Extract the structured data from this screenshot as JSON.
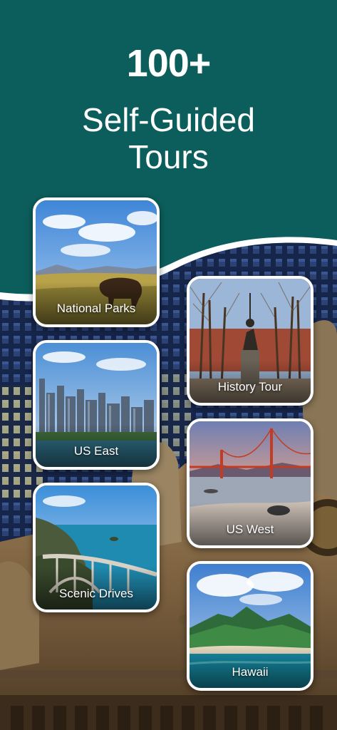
{
  "headline": {
    "count": "100+",
    "line1": "Self-Guided",
    "line2": "Tours"
  },
  "colors": {
    "teal": "#0c5e5c",
    "card_border": "#ffffff"
  },
  "cards": [
    {
      "label": "National Parks"
    },
    {
      "label": "History Tour"
    },
    {
      "label": "US East"
    },
    {
      "label": "US West"
    },
    {
      "label": "Scenic Drives"
    },
    {
      "label": "Hawaii"
    }
  ]
}
